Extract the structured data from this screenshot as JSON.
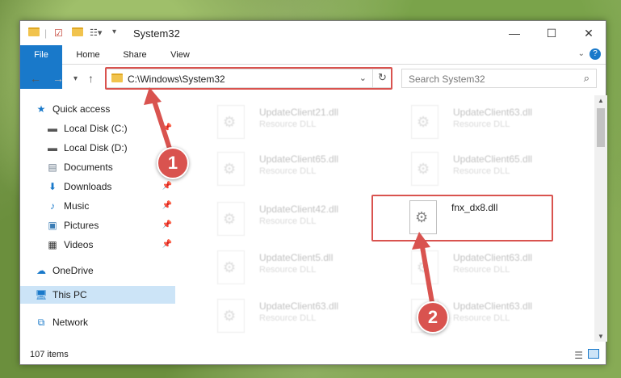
{
  "window": {
    "title": "System32",
    "controls": {
      "minimize": "—",
      "maximize": "☐",
      "close": "✕"
    }
  },
  "ribbon": {
    "tabs": [
      "File",
      "Home",
      "Share",
      "View"
    ]
  },
  "address": {
    "path": "C:\\Windows\\System32",
    "search_placeholder": "Search System32"
  },
  "nav": {
    "items": [
      {
        "label": "Quick access",
        "icon": "star-icon",
        "pinned": false
      },
      {
        "label": "Local Disk (C:)",
        "icon": "drive-icon",
        "pinned": true
      },
      {
        "label": "Local Disk (D:)",
        "icon": "drive-icon",
        "pinned": false
      },
      {
        "label": "Documents",
        "icon": "documents-icon",
        "pinned": true
      },
      {
        "label": "Downloads",
        "icon": "downloads-icon",
        "pinned": true
      },
      {
        "label": "Music",
        "icon": "music-icon",
        "pinned": true
      },
      {
        "label": "Pictures",
        "icon": "pictures-icon",
        "pinned": true
      },
      {
        "label": "Videos",
        "icon": "videos-icon",
        "pinned": true
      },
      {
        "label": "OneDrive",
        "icon": "onedrive-icon",
        "pinned": false
      },
      {
        "label": "This PC",
        "icon": "pc-icon",
        "pinned": false,
        "selected": true
      },
      {
        "label": "Network",
        "icon": "network-icon",
        "pinned": false
      }
    ]
  },
  "files": [
    {
      "name": "UpdateClient21.dll",
      "type": "Resource DLL"
    },
    {
      "name": "UpdateClient63.dll",
      "type": "Resource DLL"
    },
    {
      "name": "UpdateClient65.dll",
      "type": "Resource DLL"
    },
    {
      "name": "UpdateClient65.dll",
      "type": "Resource DLL"
    },
    {
      "name": "UpdateClient42.dll",
      "type": "Resource DLL"
    },
    {
      "name": "fnx_dx8.dll",
      "type": ""
    },
    {
      "name": "UpdateClient5.dll",
      "type": "Resource DLL"
    },
    {
      "name": "UpdateClient63.dll",
      "type": "Resource DLL"
    },
    {
      "name": "UpdateClient63.dll",
      "type": "Resource DLL"
    },
    {
      "name": "UpdateClient63.dll",
      "type": "Resource DLL"
    }
  ],
  "status": {
    "item_count": "107 items"
  },
  "annotations": {
    "step1": "1",
    "step2": "2",
    "color": "#d9534f"
  }
}
